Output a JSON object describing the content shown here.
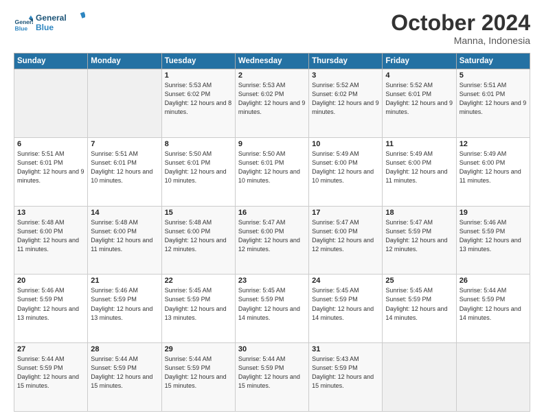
{
  "header": {
    "title": "October 2024",
    "subtitle": "Manna, Indonesia"
  },
  "days": [
    "Sunday",
    "Monday",
    "Tuesday",
    "Wednesday",
    "Thursday",
    "Friday",
    "Saturday"
  ],
  "weeks": [
    [
      {
        "day": "",
        "sunrise": "",
        "sunset": "",
        "daylight": ""
      },
      {
        "day": "",
        "sunrise": "",
        "sunset": "",
        "daylight": ""
      },
      {
        "day": "1",
        "sunrise": "Sunrise: 5:53 AM",
        "sunset": "Sunset: 6:02 PM",
        "daylight": "Daylight: 12 hours and 8 minutes."
      },
      {
        "day": "2",
        "sunrise": "Sunrise: 5:53 AM",
        "sunset": "Sunset: 6:02 PM",
        "daylight": "Daylight: 12 hours and 9 minutes."
      },
      {
        "day": "3",
        "sunrise": "Sunrise: 5:52 AM",
        "sunset": "Sunset: 6:02 PM",
        "daylight": "Daylight: 12 hours and 9 minutes."
      },
      {
        "day": "4",
        "sunrise": "Sunrise: 5:52 AM",
        "sunset": "Sunset: 6:01 PM",
        "daylight": "Daylight: 12 hours and 9 minutes."
      },
      {
        "day": "5",
        "sunrise": "Sunrise: 5:51 AM",
        "sunset": "Sunset: 6:01 PM",
        "daylight": "Daylight: 12 hours and 9 minutes."
      }
    ],
    [
      {
        "day": "6",
        "sunrise": "Sunrise: 5:51 AM",
        "sunset": "Sunset: 6:01 PM",
        "daylight": "Daylight: 12 hours and 9 minutes."
      },
      {
        "day": "7",
        "sunrise": "Sunrise: 5:51 AM",
        "sunset": "Sunset: 6:01 PM",
        "daylight": "Daylight: 12 hours and 10 minutes."
      },
      {
        "day": "8",
        "sunrise": "Sunrise: 5:50 AM",
        "sunset": "Sunset: 6:01 PM",
        "daylight": "Daylight: 12 hours and 10 minutes."
      },
      {
        "day": "9",
        "sunrise": "Sunrise: 5:50 AM",
        "sunset": "Sunset: 6:01 PM",
        "daylight": "Daylight: 12 hours and 10 minutes."
      },
      {
        "day": "10",
        "sunrise": "Sunrise: 5:49 AM",
        "sunset": "Sunset: 6:00 PM",
        "daylight": "Daylight: 12 hours and 10 minutes."
      },
      {
        "day": "11",
        "sunrise": "Sunrise: 5:49 AM",
        "sunset": "Sunset: 6:00 PM",
        "daylight": "Daylight: 12 hours and 11 minutes."
      },
      {
        "day": "12",
        "sunrise": "Sunrise: 5:49 AM",
        "sunset": "Sunset: 6:00 PM",
        "daylight": "Daylight: 12 hours and 11 minutes."
      }
    ],
    [
      {
        "day": "13",
        "sunrise": "Sunrise: 5:48 AM",
        "sunset": "Sunset: 6:00 PM",
        "daylight": "Daylight: 12 hours and 11 minutes."
      },
      {
        "day": "14",
        "sunrise": "Sunrise: 5:48 AM",
        "sunset": "Sunset: 6:00 PM",
        "daylight": "Daylight: 12 hours and 11 minutes."
      },
      {
        "day": "15",
        "sunrise": "Sunrise: 5:48 AM",
        "sunset": "Sunset: 6:00 PM",
        "daylight": "Daylight: 12 hours and 12 minutes."
      },
      {
        "day": "16",
        "sunrise": "Sunrise: 5:47 AM",
        "sunset": "Sunset: 6:00 PM",
        "daylight": "Daylight: 12 hours and 12 minutes."
      },
      {
        "day": "17",
        "sunrise": "Sunrise: 5:47 AM",
        "sunset": "Sunset: 6:00 PM",
        "daylight": "Daylight: 12 hours and 12 minutes."
      },
      {
        "day": "18",
        "sunrise": "Sunrise: 5:47 AM",
        "sunset": "Sunset: 5:59 PM",
        "daylight": "Daylight: 12 hours and 12 minutes."
      },
      {
        "day": "19",
        "sunrise": "Sunrise: 5:46 AM",
        "sunset": "Sunset: 5:59 PM",
        "daylight": "Daylight: 12 hours and 13 minutes."
      }
    ],
    [
      {
        "day": "20",
        "sunrise": "Sunrise: 5:46 AM",
        "sunset": "Sunset: 5:59 PM",
        "daylight": "Daylight: 12 hours and 13 minutes."
      },
      {
        "day": "21",
        "sunrise": "Sunrise: 5:46 AM",
        "sunset": "Sunset: 5:59 PM",
        "daylight": "Daylight: 12 hours and 13 minutes."
      },
      {
        "day": "22",
        "sunrise": "Sunrise: 5:45 AM",
        "sunset": "Sunset: 5:59 PM",
        "daylight": "Daylight: 12 hours and 13 minutes."
      },
      {
        "day": "23",
        "sunrise": "Sunrise: 5:45 AM",
        "sunset": "Sunset: 5:59 PM",
        "daylight": "Daylight: 12 hours and 14 minutes."
      },
      {
        "day": "24",
        "sunrise": "Sunrise: 5:45 AM",
        "sunset": "Sunset: 5:59 PM",
        "daylight": "Daylight: 12 hours and 14 minutes."
      },
      {
        "day": "25",
        "sunrise": "Sunrise: 5:45 AM",
        "sunset": "Sunset: 5:59 PM",
        "daylight": "Daylight: 12 hours and 14 minutes."
      },
      {
        "day": "26",
        "sunrise": "Sunrise: 5:44 AM",
        "sunset": "Sunset: 5:59 PM",
        "daylight": "Daylight: 12 hours and 14 minutes."
      }
    ],
    [
      {
        "day": "27",
        "sunrise": "Sunrise: 5:44 AM",
        "sunset": "Sunset: 5:59 PM",
        "daylight": "Daylight: 12 hours and 15 minutes."
      },
      {
        "day": "28",
        "sunrise": "Sunrise: 5:44 AM",
        "sunset": "Sunset: 5:59 PM",
        "daylight": "Daylight: 12 hours and 15 minutes."
      },
      {
        "day": "29",
        "sunrise": "Sunrise: 5:44 AM",
        "sunset": "Sunset: 5:59 PM",
        "daylight": "Daylight: 12 hours and 15 minutes."
      },
      {
        "day": "30",
        "sunrise": "Sunrise: 5:44 AM",
        "sunset": "Sunset: 5:59 PM",
        "daylight": "Daylight: 12 hours and 15 minutes."
      },
      {
        "day": "31",
        "sunrise": "Sunrise: 5:43 AM",
        "sunset": "Sunset: 5:59 PM",
        "daylight": "Daylight: 12 hours and 15 minutes."
      },
      {
        "day": "",
        "sunrise": "",
        "sunset": "",
        "daylight": ""
      },
      {
        "day": "",
        "sunrise": "",
        "sunset": "",
        "daylight": ""
      }
    ]
  ]
}
